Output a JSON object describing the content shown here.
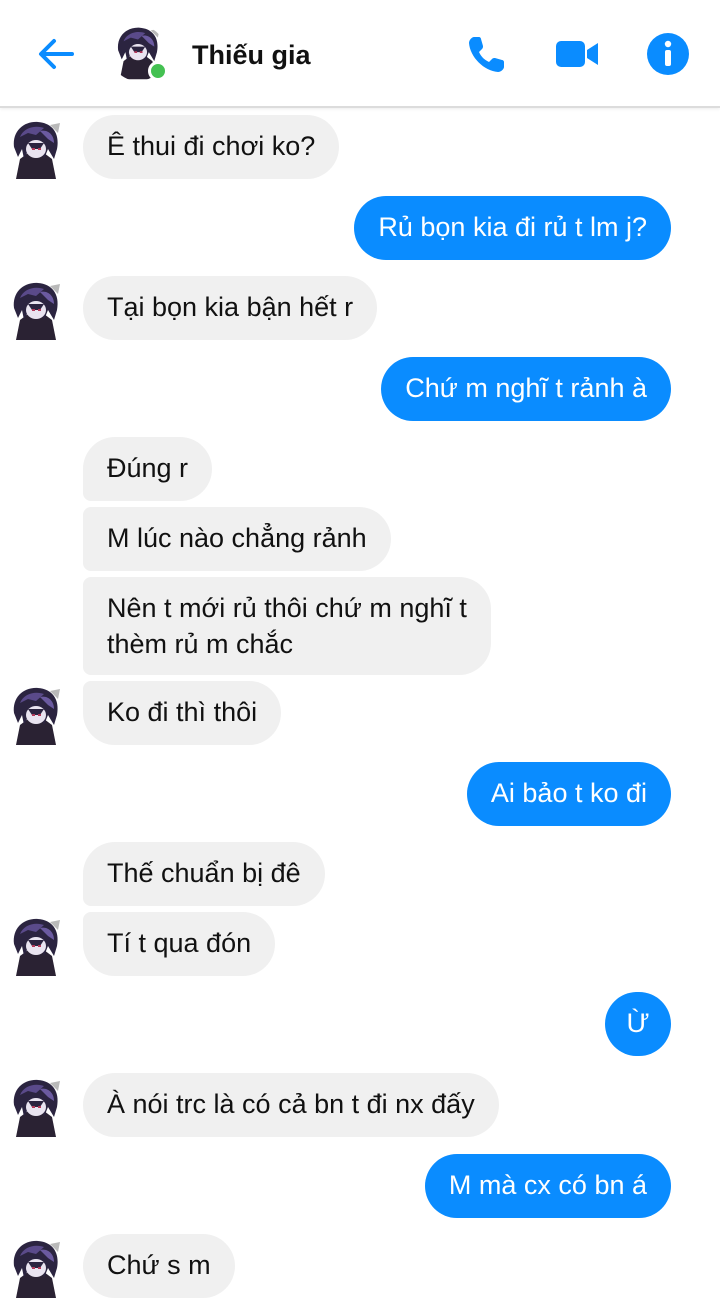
{
  "header": {
    "contact_name": "Thiếu gia",
    "status": "online",
    "accent_color": "#0a8cff",
    "icons": [
      "back-arrow-icon",
      "phone-icon",
      "video-camera-icon",
      "info-icon"
    ]
  },
  "messages": [
    {
      "side": "in",
      "text": "Ê thui đi chơi ko?"
    },
    {
      "side": "out",
      "text": "Rủ bọn kia đi rủ t lm j?"
    },
    {
      "side": "in",
      "text": "Tại bọn kia bận hết r"
    },
    {
      "side": "out",
      "text": "Chứ m nghĩ t rảnh à"
    },
    {
      "side": "in",
      "text": "Đúng r"
    },
    {
      "side": "in",
      "text": "M lúc nào chẳng rảnh"
    },
    {
      "side": "in",
      "text": "Nên t mới rủ thôi chứ m nghĩ t"
    },
    {
      "side": "in",
      "text": "thèm rủ m chắc"
    },
    {
      "side": "in",
      "text": "Ko đi thì thôi"
    },
    {
      "side": "out",
      "text": "Ai bảo t ko đi"
    },
    {
      "side": "in",
      "text": "Thế chuẩn bị đê"
    },
    {
      "side": "in",
      "text": "Tí t qua đón"
    },
    {
      "side": "out",
      "text": "Ừ"
    },
    {
      "side": "in",
      "text": "À nói trc là có cả bn t đi nx đấy"
    },
    {
      "side": "out",
      "text": "M mà cx có bn á"
    },
    {
      "side": "in",
      "text": "Chứ s m"
    }
  ]
}
